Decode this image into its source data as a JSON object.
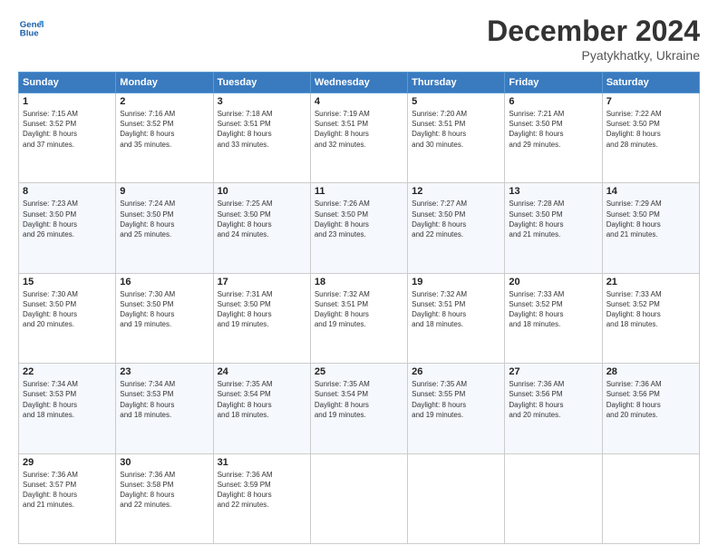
{
  "header": {
    "logo_line1": "General",
    "logo_line2": "Blue",
    "month": "December 2024",
    "location": "Pyatykhatky, Ukraine"
  },
  "days_of_week": [
    "Sunday",
    "Monday",
    "Tuesday",
    "Wednesday",
    "Thursday",
    "Friday",
    "Saturday"
  ],
  "weeks": [
    [
      {
        "day": "1",
        "lines": [
          "Sunrise: 7:15 AM",
          "Sunset: 3:52 PM",
          "Daylight: 8 hours",
          "and 37 minutes."
        ]
      },
      {
        "day": "2",
        "lines": [
          "Sunrise: 7:16 AM",
          "Sunset: 3:52 PM",
          "Daylight: 8 hours",
          "and 35 minutes."
        ]
      },
      {
        "day": "3",
        "lines": [
          "Sunrise: 7:18 AM",
          "Sunset: 3:51 PM",
          "Daylight: 8 hours",
          "and 33 minutes."
        ]
      },
      {
        "day": "4",
        "lines": [
          "Sunrise: 7:19 AM",
          "Sunset: 3:51 PM",
          "Daylight: 8 hours",
          "and 32 minutes."
        ]
      },
      {
        "day": "5",
        "lines": [
          "Sunrise: 7:20 AM",
          "Sunset: 3:51 PM",
          "Daylight: 8 hours",
          "and 30 minutes."
        ]
      },
      {
        "day": "6",
        "lines": [
          "Sunrise: 7:21 AM",
          "Sunset: 3:50 PM",
          "Daylight: 8 hours",
          "and 29 minutes."
        ]
      },
      {
        "day": "7",
        "lines": [
          "Sunrise: 7:22 AM",
          "Sunset: 3:50 PM",
          "Daylight: 8 hours",
          "and 28 minutes."
        ]
      }
    ],
    [
      {
        "day": "8",
        "lines": [
          "Sunrise: 7:23 AM",
          "Sunset: 3:50 PM",
          "Daylight: 8 hours",
          "and 26 minutes."
        ]
      },
      {
        "day": "9",
        "lines": [
          "Sunrise: 7:24 AM",
          "Sunset: 3:50 PM",
          "Daylight: 8 hours",
          "and 25 minutes."
        ]
      },
      {
        "day": "10",
        "lines": [
          "Sunrise: 7:25 AM",
          "Sunset: 3:50 PM",
          "Daylight: 8 hours",
          "and 24 minutes."
        ]
      },
      {
        "day": "11",
        "lines": [
          "Sunrise: 7:26 AM",
          "Sunset: 3:50 PM",
          "Daylight: 8 hours",
          "and 23 minutes."
        ]
      },
      {
        "day": "12",
        "lines": [
          "Sunrise: 7:27 AM",
          "Sunset: 3:50 PM",
          "Daylight: 8 hours",
          "and 22 minutes."
        ]
      },
      {
        "day": "13",
        "lines": [
          "Sunrise: 7:28 AM",
          "Sunset: 3:50 PM",
          "Daylight: 8 hours",
          "and 21 minutes."
        ]
      },
      {
        "day": "14",
        "lines": [
          "Sunrise: 7:29 AM",
          "Sunset: 3:50 PM",
          "Daylight: 8 hours",
          "and 21 minutes."
        ]
      }
    ],
    [
      {
        "day": "15",
        "lines": [
          "Sunrise: 7:30 AM",
          "Sunset: 3:50 PM",
          "Daylight: 8 hours",
          "and 20 minutes."
        ]
      },
      {
        "day": "16",
        "lines": [
          "Sunrise: 7:30 AM",
          "Sunset: 3:50 PM",
          "Daylight: 8 hours",
          "and 19 minutes."
        ]
      },
      {
        "day": "17",
        "lines": [
          "Sunrise: 7:31 AM",
          "Sunset: 3:50 PM",
          "Daylight: 8 hours",
          "and 19 minutes."
        ]
      },
      {
        "day": "18",
        "lines": [
          "Sunrise: 7:32 AM",
          "Sunset: 3:51 PM",
          "Daylight: 8 hours",
          "and 19 minutes."
        ]
      },
      {
        "day": "19",
        "lines": [
          "Sunrise: 7:32 AM",
          "Sunset: 3:51 PM",
          "Daylight: 8 hours",
          "and 18 minutes."
        ]
      },
      {
        "day": "20",
        "lines": [
          "Sunrise: 7:33 AM",
          "Sunset: 3:52 PM",
          "Daylight: 8 hours",
          "and 18 minutes."
        ]
      },
      {
        "day": "21",
        "lines": [
          "Sunrise: 7:33 AM",
          "Sunset: 3:52 PM",
          "Daylight: 8 hours",
          "and 18 minutes."
        ]
      }
    ],
    [
      {
        "day": "22",
        "lines": [
          "Sunrise: 7:34 AM",
          "Sunset: 3:53 PM",
          "Daylight: 8 hours",
          "and 18 minutes."
        ]
      },
      {
        "day": "23",
        "lines": [
          "Sunrise: 7:34 AM",
          "Sunset: 3:53 PM",
          "Daylight: 8 hours",
          "and 18 minutes."
        ]
      },
      {
        "day": "24",
        "lines": [
          "Sunrise: 7:35 AM",
          "Sunset: 3:54 PM",
          "Daylight: 8 hours",
          "and 18 minutes."
        ]
      },
      {
        "day": "25",
        "lines": [
          "Sunrise: 7:35 AM",
          "Sunset: 3:54 PM",
          "Daylight: 8 hours",
          "and 19 minutes."
        ]
      },
      {
        "day": "26",
        "lines": [
          "Sunrise: 7:35 AM",
          "Sunset: 3:55 PM",
          "Daylight: 8 hours",
          "and 19 minutes."
        ]
      },
      {
        "day": "27",
        "lines": [
          "Sunrise: 7:36 AM",
          "Sunset: 3:56 PM",
          "Daylight: 8 hours",
          "and 20 minutes."
        ]
      },
      {
        "day": "28",
        "lines": [
          "Sunrise: 7:36 AM",
          "Sunset: 3:56 PM",
          "Daylight: 8 hours",
          "and 20 minutes."
        ]
      }
    ],
    [
      {
        "day": "29",
        "lines": [
          "Sunrise: 7:36 AM",
          "Sunset: 3:57 PM",
          "Daylight: 8 hours",
          "and 21 minutes."
        ]
      },
      {
        "day": "30",
        "lines": [
          "Sunrise: 7:36 AM",
          "Sunset: 3:58 PM",
          "Daylight: 8 hours",
          "and 22 minutes."
        ]
      },
      {
        "day": "31",
        "lines": [
          "Sunrise: 7:36 AM",
          "Sunset: 3:59 PM",
          "Daylight: 8 hours",
          "and 22 minutes."
        ]
      },
      null,
      null,
      null,
      null
    ]
  ]
}
